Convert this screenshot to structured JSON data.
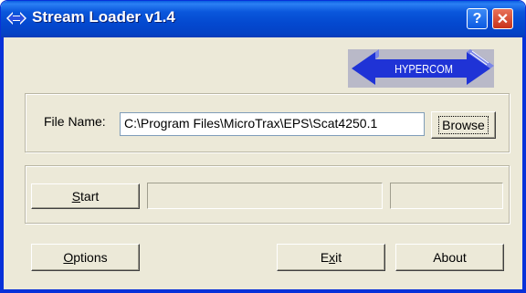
{
  "window": {
    "title": "Stream Loader v1.4",
    "help_glyph": "?",
    "close_glyph": "✕",
    "title_icon": "double-arrow-icon"
  },
  "logo": {
    "text": "HYPERCOM",
    "icon": "hypercom-double-arrow-logo"
  },
  "file": {
    "label": "File Name:",
    "value": "C:\\Program Files\\MicroTrax\\EPS\\Scat4250.1",
    "browse_label": "Browse"
  },
  "actions": {
    "start_label": "Start",
    "start_mnemonic": "S",
    "start_rest": "tart",
    "progress_value": "",
    "status_text": ""
  },
  "bottom": {
    "options_mnemonic": "O",
    "options_rest": "ptions",
    "exit_first": "E",
    "exit_mnemonic": "x",
    "exit_rest": "it",
    "about_label": "About"
  },
  "colors": {
    "titlebar": "#0a57dc",
    "face": "#ece9d8",
    "logo_bg": "#b9b9c8",
    "logo_arrow": "#1f33d6"
  }
}
